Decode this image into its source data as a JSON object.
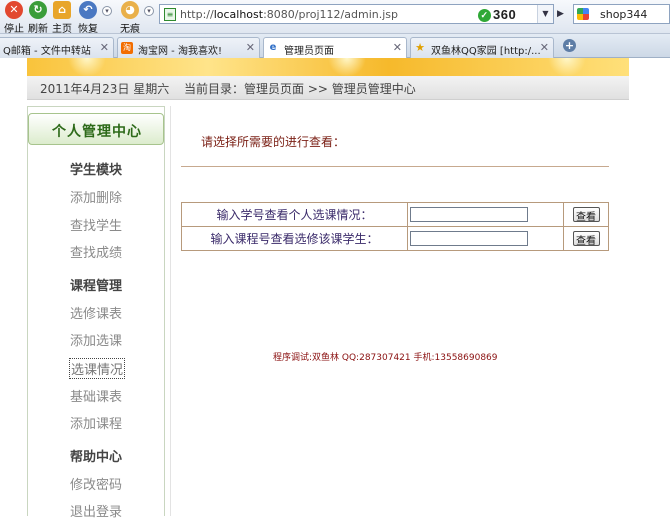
{
  "browser": {
    "buttons": [
      {
        "label": "停止",
        "icon": "stop-icon"
      },
      {
        "label": "刷新",
        "icon": "refresh-icon"
      },
      {
        "label": "主页",
        "icon": "home-icon"
      },
      {
        "label": "恢复",
        "icon": "undo-icon"
      },
      {
        "label": "无痕",
        "icon": "incognito-icon"
      }
    ],
    "address": {
      "prefix": "http://",
      "host": "localhost",
      "rest": ":8080/proj112/admin.jsp",
      "brand": "360"
    },
    "search_text": "shop344",
    "tabs": [
      {
        "label": "Q邮箱 - 文件中转站",
        "icon": ""
      },
      {
        "label": "淘宝网 - 淘我喜欢!",
        "icon": "淘"
      },
      {
        "label": "管理员页面",
        "icon": "e"
      },
      {
        "label": "双鱼林QQ家园 [http:/...",
        "icon": "★"
      }
    ],
    "colors": {
      "secure": "#2fa836",
      "accent": "#5d7da6"
    }
  },
  "header": {
    "date": "2011年4月23日  星期六",
    "breadcrumb": "当前目录：管理员页面  >>  管理员管理中心"
  },
  "sidebar": {
    "title": "个人管理中心",
    "groups": [
      {
        "heading": "学生模块",
        "items": [
          "添加删除",
          "查找学生",
          "查找成绩"
        ]
      },
      {
        "heading": "课程管理",
        "items": [
          "选修课表",
          "添加选课",
          "选课情况",
          "基础课表",
          "添加课程"
        ]
      },
      {
        "heading": "帮助中心",
        "items": [
          "修改密码",
          "退出登录"
        ]
      }
    ]
  },
  "main": {
    "prompt": "请选择所需要的进行查看：",
    "rows": [
      {
        "label": "输入学号查看个人选课情况：",
        "value": "",
        "button": "查看"
      },
      {
        "label": "输入课程号查看选修该课学生：",
        "value": "",
        "button": "查看"
      }
    ],
    "footer": "程序调试:双鱼林 QQ:287307421 手机:13558690869"
  }
}
